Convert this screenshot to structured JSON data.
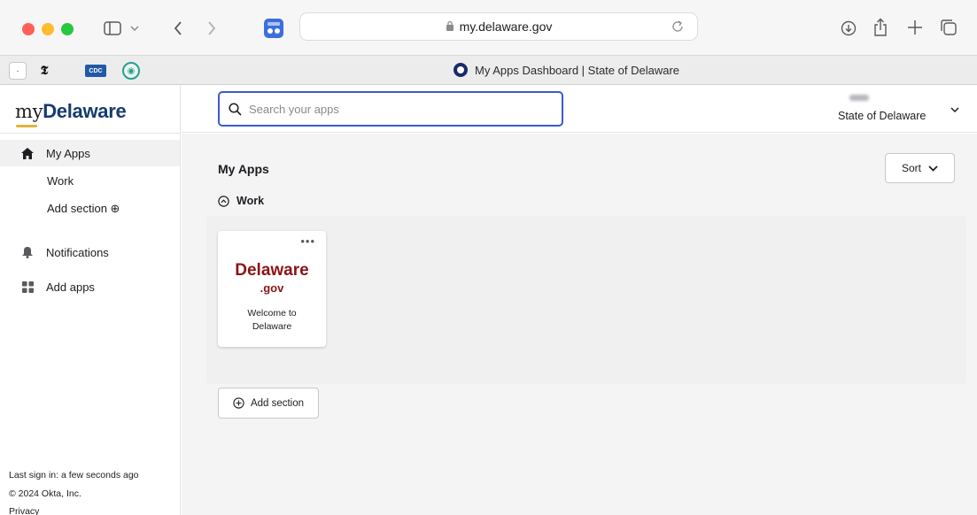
{
  "browser": {
    "url": "my.delaware.gov",
    "tab_title": "My Apps Dashboard | State of Delaware",
    "colors": {
      "close": "#ff5f57",
      "minimize": "#febc2e",
      "maximize": "#28c840",
      "tab_tile": "#3b6fdc"
    },
    "favorites": [
      {
        "name": "dot-favorite",
        "glyph": "·"
      },
      {
        "name": "nyt-favorite",
        "glyph": "𝕿"
      },
      {
        "name": "cdc-favorite",
        "glyph": "CDC"
      },
      {
        "name": "who-favorite",
        "glyph": "◉"
      }
    ]
  },
  "sidebar": {
    "logo_my": "my",
    "logo_delaware": "Delaware",
    "items": [
      {
        "label": "My Apps",
        "icon": "home-icon"
      },
      {
        "label": "Notifications",
        "icon": "bell-icon"
      },
      {
        "label": "Add apps",
        "icon": "grid-icon"
      }
    ],
    "sub_items": [
      {
        "label": "Work"
      },
      {
        "label": "Add section ⊕"
      }
    ],
    "footer": {
      "last_sign_in": "Last sign in: a few seconds ago",
      "copyright": "© 2024 Okta, Inc.",
      "privacy": "Privacy"
    }
  },
  "header": {
    "search_placeholder": "Search your apps",
    "org_name": "State of Delaware"
  },
  "main": {
    "title": "My Apps",
    "sort_label": "Sort",
    "section": {
      "name": "Work",
      "tiles": [
        {
          "brand_line1": "Delaware",
          "brand_line2": ".gov",
          "label": "Welcome to Delaware",
          "brand_color": "#8b1416"
        }
      ]
    },
    "add_section_label": "Add section"
  }
}
